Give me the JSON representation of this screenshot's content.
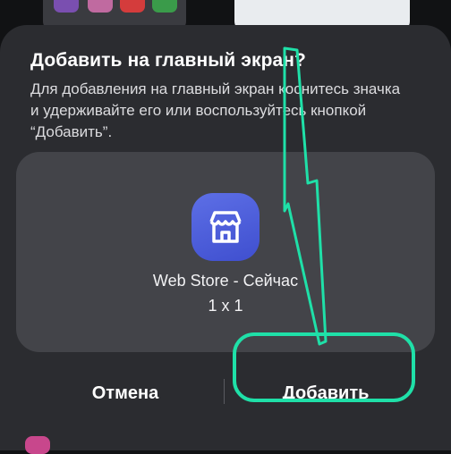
{
  "dialog": {
    "title": "Добавить на главный экран?",
    "description_line1": "Для добавления на главный экран коснитесь значка",
    "description_line2": "и удерживайте его или воспользуйтесь кнопкой",
    "description_line3": "“Добавить”.",
    "app": {
      "name": "Web Store - Сейчас",
      "size": "1 x 1",
      "icon": "store-icon"
    },
    "cancel_label": "Отмена",
    "add_label": "Добавить"
  },
  "colors": {
    "dialog_bg": "#2b2c30",
    "preview_bg": "#434449",
    "icon_bg": "#4a5ad8",
    "highlight": "#1fe0a8"
  }
}
